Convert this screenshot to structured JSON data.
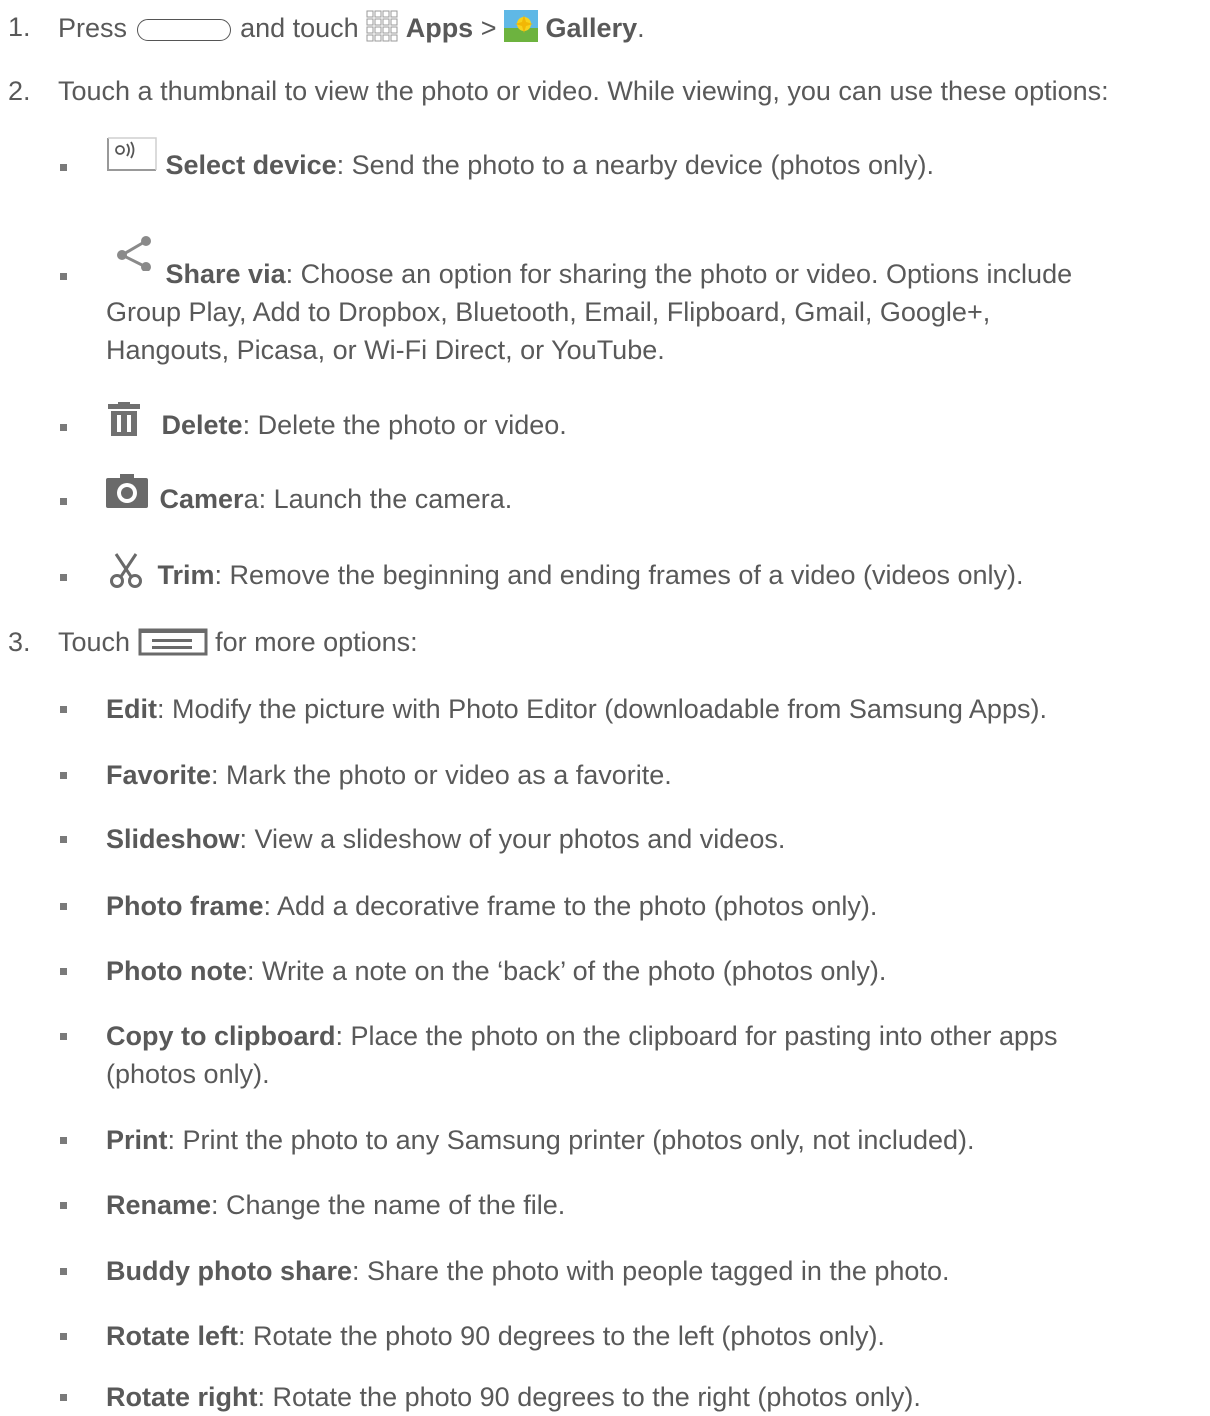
{
  "step1": {
    "num": "1.",
    "press": "Press",
    "and_touch": "and touch",
    "apps": "Apps",
    "sep": ">",
    "gallery": "Gallery",
    "end": "."
  },
  "step2": {
    "num": "2.",
    "text": "Touch a thumbnail to view the photo or video. While viewing, you can use these options:",
    "options": [
      {
        "name": "Select device",
        "desc": ": Send the photo to a nearby device (photos only)."
      },
      {
        "name": "Share via",
        "desc": ": Choose an option for sharing the photo or video. Options include",
        "desc2": "Group Play, Add to Dropbox, Bluetooth, Email, Flipboard, Gmail, Google+,",
        "desc3": "Hangouts, Picasa, or Wi-Fi Direct, or YouTube."
      },
      {
        "name": "Delete",
        "desc": ": Delete the photo or video."
      },
      {
        "name": "Camer",
        "name_tail": "a",
        "desc": ": Launch the camera."
      },
      {
        "name": "Trim",
        "desc": ": Remove the beginning and ending frames of a video (videos only)."
      }
    ]
  },
  "step3": {
    "num": "3.",
    "touch": "Touch",
    "more": "for more options:",
    "options": [
      {
        "name": "Edit",
        "desc": ": Modify the picture with Photo Editor (downloadable from Samsung Apps)."
      },
      {
        "name": "Favorite",
        "desc": ": Mark the photo or video as a favorite."
      },
      {
        "name": "Slideshow",
        "desc": ": View a slideshow of your photos and videos."
      },
      {
        "name": "Photo frame",
        "desc": ": Add a decorative frame to the photo (photos only)."
      },
      {
        "name": "Photo note",
        "desc": ": Write a note on the ‘back’ of the photo (photos only)."
      },
      {
        "name": "Copy to clipboard",
        "desc": ": Place the photo on the clipboard for pasting into other apps",
        "desc2": "(photos only)."
      },
      {
        "name": "Print",
        "desc": ": Print the photo to any Samsung printer (photos only, not included)."
      },
      {
        "name": "Rename",
        "desc": ": Change the name of the file."
      },
      {
        "name": "Buddy photo share",
        "desc": ": Share the photo with people tagged in the photo."
      },
      {
        "name": "Rotate left",
        "desc": ": Rotate the photo 90 degrees to the left (photos only)."
      },
      {
        "name": "Rotate right",
        "desc": ": Rotate the photo 90 degrees to the right (photos only)."
      }
    ]
  }
}
